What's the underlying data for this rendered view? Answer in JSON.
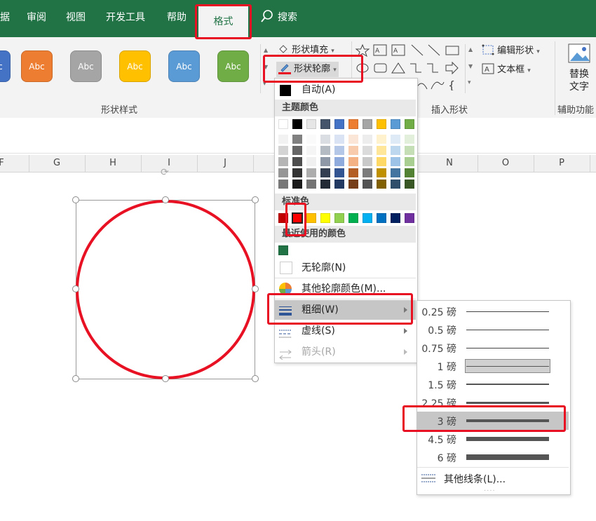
{
  "tabs": {
    "data": "据",
    "review": "审阅",
    "view": "视图",
    "developer": "开发工具",
    "help": "帮助",
    "format": "格式",
    "search": "搜索"
  },
  "ribbon": {
    "style_swatch_label": "Abc",
    "style_swatches": [
      {
        "color": "#4472c4"
      },
      {
        "color": "#ed7d31"
      },
      {
        "color": "#a5a5a5"
      },
      {
        "color": "#ffc000"
      },
      {
        "color": "#5b9bd5"
      },
      {
        "color": "#70ad47"
      }
    ],
    "shape_fill": "形状填充",
    "shape_outline": "形状轮廓",
    "edit_shape": "编辑形状",
    "text_box": "文本框",
    "replace_text": "替换文字",
    "group_shape_styles": "形状样式",
    "group_insert_shapes": "插入形状",
    "group_accessibility": "辅助功能"
  },
  "columns": [
    "F",
    "G",
    "H",
    "I",
    "J",
    "N",
    "O",
    "P"
  ],
  "outline_menu": {
    "auto": "自动(A)",
    "theme_colors_header": "主题颜色",
    "standard_colors_header": "标准色",
    "recent_colors_header": "最近使用的颜色",
    "no_outline": "无轮廓(N)",
    "more_colors": "其他轮廓颜色(M)...",
    "weight": "粗细(W)",
    "dashes": "虚线(S)",
    "arrows": "箭头(R)",
    "theme_top_row": [
      "#ffffff",
      "#000000",
      "#e7e6e6",
      "#44546a",
      "#4472c4",
      "#ed7d31",
      "#a5a5a5",
      "#ffc000",
      "#5b9bd5",
      "#70ad47"
    ],
    "standard_colors": [
      "#c00000",
      "#ff0000",
      "#ffc000",
      "#ffff00",
      "#92d050",
      "#00b050",
      "#00b0f0",
      "#0070c0",
      "#002060",
      "#7030a0"
    ],
    "recent_color": "#217346",
    "selected_standard": "#ff0000"
  },
  "weight_menu": {
    "items": [
      {
        "label": "0.25 磅",
        "pt": 0.25
      },
      {
        "label": "0.5 磅",
        "pt": 0.5
      },
      {
        "label": "0.75 磅",
        "pt": 0.75
      },
      {
        "label": "1 磅",
        "pt": 1
      },
      {
        "label": "1.5 磅",
        "pt": 1.5
      },
      {
        "label": "2.25 磅",
        "pt": 2.25
      },
      {
        "label": "3 磅",
        "pt": 3
      },
      {
        "label": "4.5 磅",
        "pt": 4.5
      },
      {
        "label": "6 磅",
        "pt": 6
      }
    ],
    "current": "1 磅",
    "highlighted": "3 磅",
    "more_lines": "其他线条(L)..."
  },
  "shape": {
    "outline_color": "#e81123"
  },
  "colors": {
    "excel_green": "#217346",
    "annotation_red": "#e81123"
  }
}
